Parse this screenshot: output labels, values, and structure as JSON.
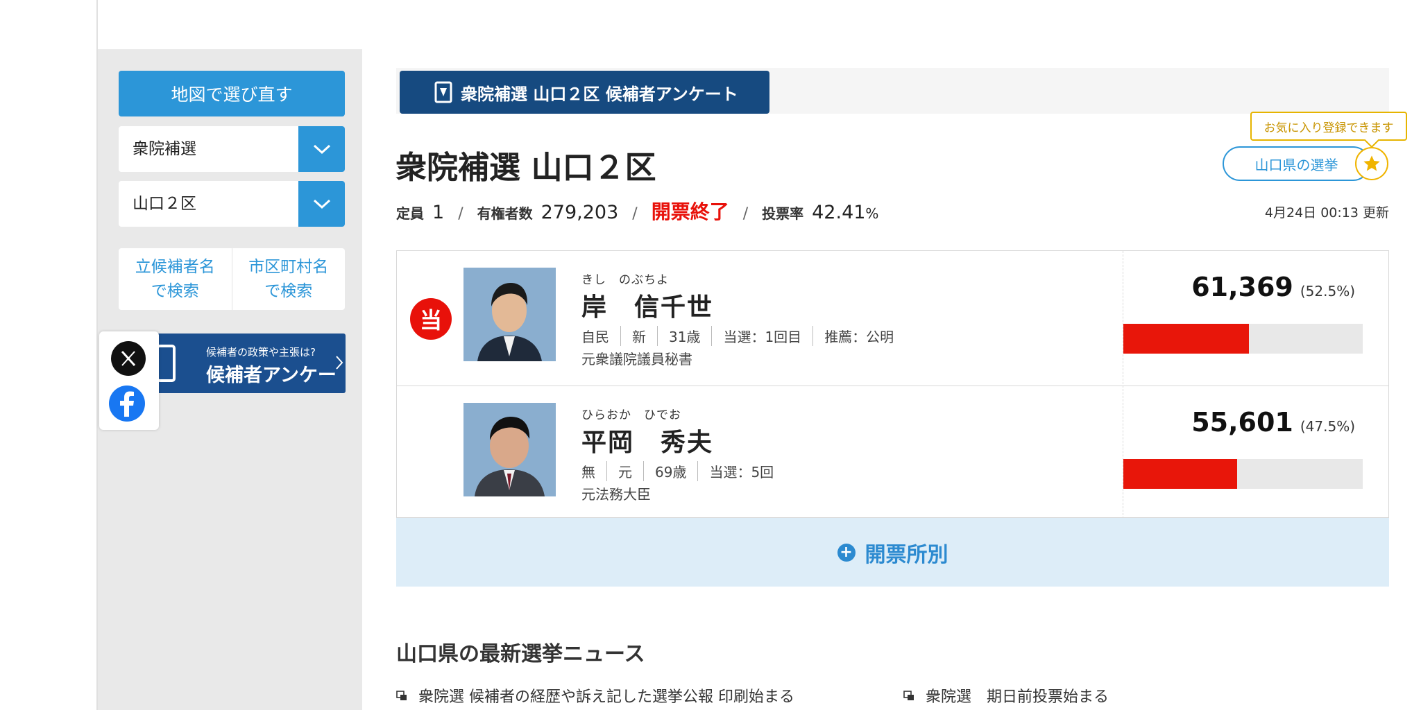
{
  "sidebar": {
    "map_button": "地図で選び直す",
    "election_select": "衆院補選",
    "district_select": "山口２区",
    "search_candidate": [
      "立候補者名",
      "で検索"
    ],
    "search_city": [
      "市区町村名",
      "で検索"
    ],
    "banner": {
      "sub": "候補者の政策や主張は?",
      "main": "候補者アンケート"
    }
  },
  "share": {
    "x": "X",
    "facebook": "Facebook"
  },
  "header": {
    "tab_label": "衆院補選 山口２区 候補者アンケート"
  },
  "page": {
    "title": "衆院補選 山口２区",
    "pref_button": "山口県の選挙",
    "favorite_tooltip": "お気に入り登録できます",
    "stats": {
      "seats_label": "定員",
      "seats": "1",
      "voters_label": "有権者数",
      "voters": "279,203",
      "status": "開票終了",
      "turnout_label": "投票率",
      "turnout": "42.41",
      "turnout_unit": "%",
      "separator": "/"
    },
    "updated": "4月24日 00:13 更新"
  },
  "candidates": [
    {
      "kana": "きし　のぶちよ",
      "name": "岸　信千世",
      "winner_badge": "当",
      "meta": [
        "自民",
        "新",
        "31歳",
        "当選：1回目",
        "推薦：公明"
      ],
      "career": "元衆議院議員秘書",
      "votes": "61,369",
      "pct": "(52.5%)",
      "share": 0.525
    },
    {
      "kana": "ひらおか　ひでお",
      "name": "平岡　秀夫",
      "meta": [
        "無",
        "元",
        "69歳",
        "当選：5回"
      ],
      "career": "元法務大臣",
      "votes": "55,601",
      "pct": "(47.5%)",
      "share": 0.475
    }
  ],
  "by_station": {
    "plus": "+",
    "label": "開票所別"
  },
  "news": {
    "title": "山口県の最新選挙ニュース",
    "items": [
      "衆院選 候補者の経歴や訴え記した選挙公報 印刷始まる",
      "衆院選　期日前投票始まる"
    ]
  },
  "colors": {
    "accent": "#2c96d8",
    "navy": "#164a80",
    "red": "#e8110a",
    "gold": "#f0b400"
  }
}
